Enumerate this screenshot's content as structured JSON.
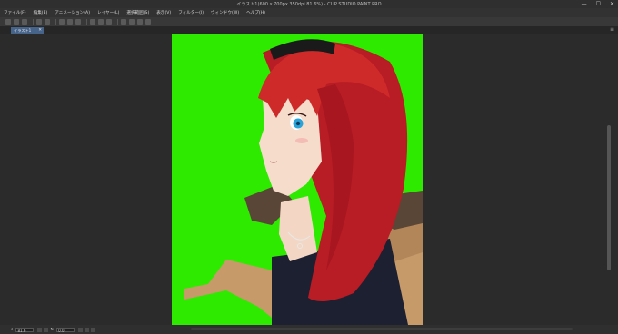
{
  "window": {
    "title": "イラスト1(600 x 700px 350dpi 81.6%) - CLIP STUDIO PAINT PRO",
    "controls": {
      "minimize": "—",
      "maximize": "☐",
      "close": "✕"
    }
  },
  "menu": [
    {
      "label": "ファイル(F)"
    },
    {
      "label": "編集(E)"
    },
    {
      "label": "アニメーション(A)"
    },
    {
      "label": "レイヤー(L)"
    },
    {
      "label": "選択範囲(S)"
    },
    {
      "label": "表示(V)"
    },
    {
      "label": "フィルター(I)"
    },
    {
      "label": "ウィンドウ(W)"
    },
    {
      "label": "ヘルプ(H)"
    }
  ],
  "tab": {
    "label": "イラスト1",
    "close": "✕"
  },
  "tab_menu": "≡",
  "canvas": {
    "background": "#2dea00"
  },
  "status": {
    "zoom": "81.6",
    "angle": "0.0"
  }
}
